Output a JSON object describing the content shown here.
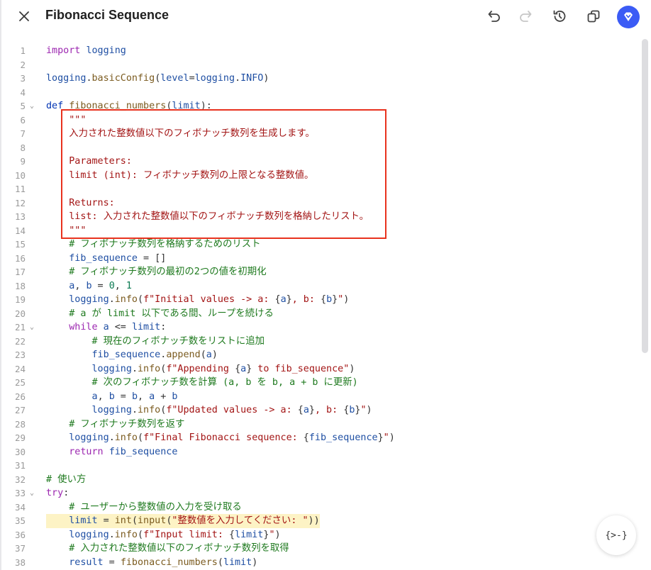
{
  "header": {
    "title": "Fibonacci Sequence",
    "icons": [
      "close-icon",
      "undo-icon",
      "redo-icon",
      "history-icon",
      "copy-icon",
      "app-logo-icon"
    ]
  },
  "editor": {
    "fab_label": "{>-}",
    "lines": [
      [
        {
          "c": "kw",
          "t": "import"
        },
        {
          "c": "",
          "t": " "
        },
        {
          "c": "vb",
          "t": "logging"
        }
      ],
      [],
      [
        {
          "c": "vb",
          "t": "logging"
        },
        {
          "c": "op",
          "t": "."
        },
        {
          "c": "fn",
          "t": "basicConfig"
        },
        {
          "c": "op",
          "t": "("
        },
        {
          "c": "vb",
          "t": "level"
        },
        {
          "c": "op",
          "t": "="
        },
        {
          "c": "vb",
          "t": "logging"
        },
        {
          "c": "op",
          "t": "."
        },
        {
          "c": "vb",
          "t": "INFO"
        },
        {
          "c": "op",
          "t": ")"
        }
      ],
      [],
      [
        {
          "c": "kwb",
          "t": "def"
        },
        {
          "c": "",
          "t": " "
        },
        {
          "c": "fn",
          "t": "fibonacci_numbers"
        },
        {
          "c": "op",
          "t": "("
        },
        {
          "c": "vb",
          "t": "limit"
        },
        {
          "c": "op",
          "t": "):"
        }
      ],
      [
        {
          "c": "st",
          "t": "    \"\"\""
        }
      ],
      [
        {
          "c": "st",
          "t": "    入力された整数値以下のフィボナッチ数列を生成します。"
        }
      ],
      [],
      [
        {
          "c": "st",
          "t": "    Parameters:"
        }
      ],
      [
        {
          "c": "st",
          "t": "    limit (int): フィボナッチ数列の上限となる整数値。"
        }
      ],
      [],
      [
        {
          "c": "st",
          "t": "    Returns:"
        }
      ],
      [
        {
          "c": "st",
          "t": "    list: 入力された整数値以下のフィボナッチ数列を格納したリスト。"
        }
      ],
      [
        {
          "c": "st",
          "t": "    \"\"\""
        }
      ],
      [
        {
          "c": "cm",
          "t": "    # フィボナッチ数列を格納するためのリスト"
        }
      ],
      [
        {
          "c": "",
          "t": "    "
        },
        {
          "c": "vb",
          "t": "fib_sequence"
        },
        {
          "c": "op",
          "t": " = []"
        }
      ],
      [
        {
          "c": "cm",
          "t": "    # フィボナッチ数列の最初の2つの値を初期化"
        }
      ],
      [
        {
          "c": "",
          "t": "    "
        },
        {
          "c": "vb",
          "t": "a"
        },
        {
          "c": "op",
          "t": ", "
        },
        {
          "c": "vb",
          "t": "b"
        },
        {
          "c": "op",
          "t": " = "
        },
        {
          "c": "nu",
          "t": "0"
        },
        {
          "c": "op",
          "t": ", "
        },
        {
          "c": "nu",
          "t": "1"
        }
      ],
      [
        {
          "c": "",
          "t": "    "
        },
        {
          "c": "vb",
          "t": "logging"
        },
        {
          "c": "op",
          "t": "."
        },
        {
          "c": "fn",
          "t": "info"
        },
        {
          "c": "op",
          "t": "("
        },
        {
          "c": "st",
          "t": "f\"Initial values -> a: "
        },
        {
          "c": "op",
          "t": "{"
        },
        {
          "c": "vb",
          "t": "a"
        },
        {
          "c": "op",
          "t": "}"
        },
        {
          "c": "st",
          "t": ", b: "
        },
        {
          "c": "op",
          "t": "{"
        },
        {
          "c": "vb",
          "t": "b"
        },
        {
          "c": "op",
          "t": "}"
        },
        {
          "c": "st",
          "t": "\""
        },
        {
          "c": "op",
          "t": ")"
        }
      ],
      [
        {
          "c": "cm",
          "t": "    # a が limit 以下である間、ループを続ける"
        }
      ],
      [
        {
          "c": "",
          "t": "    "
        },
        {
          "c": "kw",
          "t": "while"
        },
        {
          "c": "",
          "t": " "
        },
        {
          "c": "vb",
          "t": "a"
        },
        {
          "c": "op",
          "t": " <= "
        },
        {
          "c": "vb",
          "t": "limit"
        },
        {
          "c": "op",
          "t": ":"
        }
      ],
      [
        {
          "c": "cm",
          "t": "        # 現在のフィボナッチ数をリストに追加"
        }
      ],
      [
        {
          "c": "",
          "t": "        "
        },
        {
          "c": "vb",
          "t": "fib_sequence"
        },
        {
          "c": "op",
          "t": "."
        },
        {
          "c": "fn",
          "t": "append"
        },
        {
          "c": "op",
          "t": "("
        },
        {
          "c": "vb",
          "t": "a"
        },
        {
          "c": "op",
          "t": ")"
        }
      ],
      [
        {
          "c": "",
          "t": "        "
        },
        {
          "c": "vb",
          "t": "logging"
        },
        {
          "c": "op",
          "t": "."
        },
        {
          "c": "fn",
          "t": "info"
        },
        {
          "c": "op",
          "t": "("
        },
        {
          "c": "st",
          "t": "f\"Appending "
        },
        {
          "c": "op",
          "t": "{"
        },
        {
          "c": "vb",
          "t": "a"
        },
        {
          "c": "op",
          "t": "}"
        },
        {
          "c": "st",
          "t": " to fib_sequence\""
        },
        {
          "c": "op",
          "t": ")"
        }
      ],
      [
        {
          "c": "cm",
          "t": "        # 次のフィボナッチ数を計算 (a, b を b, a + b に更新)"
        }
      ],
      [
        {
          "c": "",
          "t": "        "
        },
        {
          "c": "vb",
          "t": "a"
        },
        {
          "c": "op",
          "t": ", "
        },
        {
          "c": "vb",
          "t": "b"
        },
        {
          "c": "op",
          "t": " = "
        },
        {
          "c": "vb",
          "t": "b"
        },
        {
          "c": "op",
          "t": ", "
        },
        {
          "c": "vb",
          "t": "a"
        },
        {
          "c": "op",
          "t": " + "
        },
        {
          "c": "vb",
          "t": "b"
        }
      ],
      [
        {
          "c": "",
          "t": "        "
        },
        {
          "c": "vb",
          "t": "logging"
        },
        {
          "c": "op",
          "t": "."
        },
        {
          "c": "fn",
          "t": "info"
        },
        {
          "c": "op",
          "t": "("
        },
        {
          "c": "st",
          "t": "f\"Updated values -> a: "
        },
        {
          "c": "op",
          "t": "{"
        },
        {
          "c": "vb",
          "t": "a"
        },
        {
          "c": "op",
          "t": "}"
        },
        {
          "c": "st",
          "t": ", b: "
        },
        {
          "c": "op",
          "t": "{"
        },
        {
          "c": "vb",
          "t": "b"
        },
        {
          "c": "op",
          "t": "}"
        },
        {
          "c": "st",
          "t": "\""
        },
        {
          "c": "op",
          "t": ")"
        }
      ],
      [
        {
          "c": "cm",
          "t": "    # フィボナッチ数列を返す"
        }
      ],
      [
        {
          "c": "",
          "t": "    "
        },
        {
          "c": "vb",
          "t": "logging"
        },
        {
          "c": "op",
          "t": "."
        },
        {
          "c": "fn",
          "t": "info"
        },
        {
          "c": "op",
          "t": "("
        },
        {
          "c": "st",
          "t": "f\"Final Fibonacci sequence: "
        },
        {
          "c": "op",
          "t": "{"
        },
        {
          "c": "vb",
          "t": "fib_sequence"
        },
        {
          "c": "op",
          "t": "}"
        },
        {
          "c": "st",
          "t": "\""
        },
        {
          "c": "op",
          "t": ")"
        }
      ],
      [
        {
          "c": "",
          "t": "    "
        },
        {
          "c": "kw",
          "t": "return"
        },
        {
          "c": "",
          "t": " "
        },
        {
          "c": "vb",
          "t": "fib_sequence"
        }
      ],
      [],
      [
        {
          "c": "cm",
          "t": "# 使い方"
        }
      ],
      [
        {
          "c": "kw",
          "t": "try"
        },
        {
          "c": "op",
          "t": ":"
        }
      ],
      [
        {
          "c": "cm",
          "t": "    # ユーザーから整数値の入力を受け取る"
        }
      ],
      [
        {
          "c": "",
          "t": "    "
        },
        {
          "c": "vb",
          "t": "limit"
        },
        {
          "c": "op",
          "t": " = "
        },
        {
          "c": "fn",
          "t": "int"
        },
        {
          "c": "op",
          "t": "("
        },
        {
          "c": "fn",
          "t": "input"
        },
        {
          "c": "op",
          "t": "("
        },
        {
          "c": "st",
          "t": "\"整数値を入力してください: \""
        },
        {
          "c": "op",
          "t": "))"
        }
      ],
      [
        {
          "c": "",
          "t": "    "
        },
        {
          "c": "vb",
          "t": "logging"
        },
        {
          "c": "op",
          "t": "."
        },
        {
          "c": "fn",
          "t": "info"
        },
        {
          "c": "op",
          "t": "("
        },
        {
          "c": "st",
          "t": "f\"Input limit: "
        },
        {
          "c": "op",
          "t": "{"
        },
        {
          "c": "vb",
          "t": "limit"
        },
        {
          "c": "op",
          "t": "}"
        },
        {
          "c": "st",
          "t": "\""
        },
        {
          "c": "op",
          "t": ")"
        }
      ],
      [
        {
          "c": "cm",
          "t": "    # 入力された整数値以下のフィボナッチ数列を取得"
        }
      ],
      [
        {
          "c": "",
          "t": "    "
        },
        {
          "c": "vb",
          "t": "result"
        },
        {
          "c": "op",
          "t": " = "
        },
        {
          "c": "fn",
          "t": "fibonacci_numbers"
        },
        {
          "c": "op",
          "t": "("
        },
        {
          "c": "vb",
          "t": "limit"
        },
        {
          "c": "op",
          "t": ")"
        }
      ]
    ],
    "fold_lines": [
      5,
      21,
      33
    ],
    "highlight_line": 35,
    "annotation_box_lines": [
      6,
      14
    ]
  }
}
